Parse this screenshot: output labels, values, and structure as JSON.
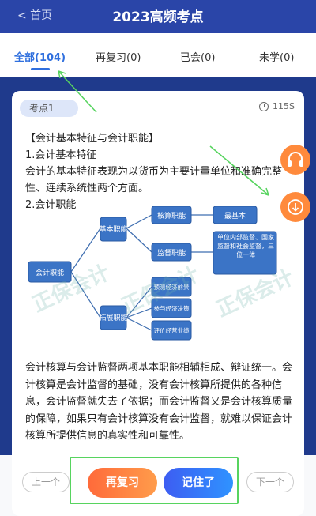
{
  "header": {
    "back_label": "< 首页",
    "title": "2023高频考点"
  },
  "tabs": [
    {
      "label": "全部(104)",
      "active": true
    },
    {
      "label": "再复习(0)",
      "active": false
    },
    {
      "label": "已会(0)",
      "active": false
    },
    {
      "label": "未学(0)",
      "active": false
    }
  ],
  "card": {
    "badge": "考点1",
    "timer": "115S",
    "paragraphs": [
      "【会计基本特征与会计职能】",
      "1.会计基本特征",
      "会计的基本特征表现为以货币为主要计量单位和准确完整性、连续系统性两个方面。",
      "2.会计职能"
    ],
    "diagram": {
      "root": "会计职能",
      "basic": "基本职能",
      "extended": "拓展职能",
      "accounting": "核算职能",
      "most_basic": "最基本",
      "supervision": "监督职能",
      "supervision_note": "单位内部监督、国家监督和社会监督，三位一体",
      "ext_items": [
        "预测经济前景",
        "参与经济决策",
        "评价经营业绩"
      ]
    },
    "watermark": "正保会计",
    "closing_text": "会计核算与会计监督两项基本职能相辅相成、辩证统一。会计核算是会计监督的基础，没有会计核算所提供的各种信息，会计监督就失去了依据；而会计监督又是会计核算质量的保障，如果只有会计核算没有会计监督，就难以保证会计核算所提供信息的真实性和可靠性。"
  },
  "footer": {
    "prev": "上一个",
    "review": "再复习",
    "known": "记住了",
    "next": "下一个"
  },
  "float_buttons": [
    "headset-icon",
    "download-icon"
  ],
  "colors": {
    "accent": "#2f6fde",
    "header_bg": "#2a45a8",
    "orange": "#ff8a3c",
    "annotation": "#57d45f"
  }
}
